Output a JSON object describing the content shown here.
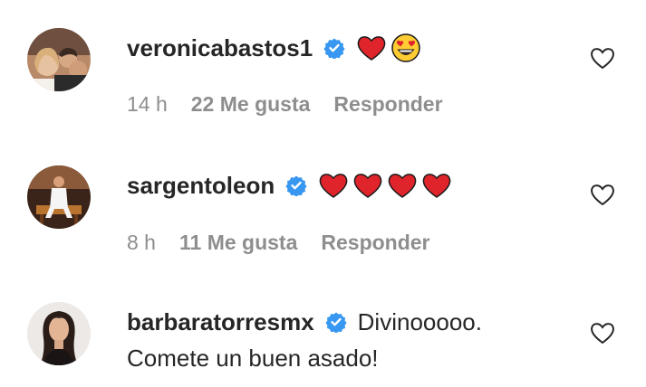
{
  "comments": [
    {
      "username": "veronicabastos1",
      "verified": true,
      "emojis": [
        "red-heart",
        "heart-eyes-face"
      ],
      "time": "14 h",
      "likes": "22 Me gusta",
      "reply": "Responder"
    },
    {
      "username": "sargentoleon",
      "verified": true,
      "emojis": [
        "red-heart",
        "red-heart",
        "red-heart",
        "red-heart"
      ],
      "time": "8 h",
      "likes": "11 Me gusta",
      "reply": "Responder"
    },
    {
      "username": "barbaratorresmx",
      "verified": true,
      "text_line1": "Divinooooo.",
      "text_line2": "Comete un buen asado!"
    }
  ],
  "colors": {
    "verified_badge": "#3897f0",
    "emoji_heart": "#e0242b",
    "meta_text": "#8e8e8e",
    "primary_text": "#262626"
  },
  "icons": [
    "verified-icon",
    "like-heart-icon",
    "red-heart-emoji",
    "heart-eyes-emoji"
  ]
}
